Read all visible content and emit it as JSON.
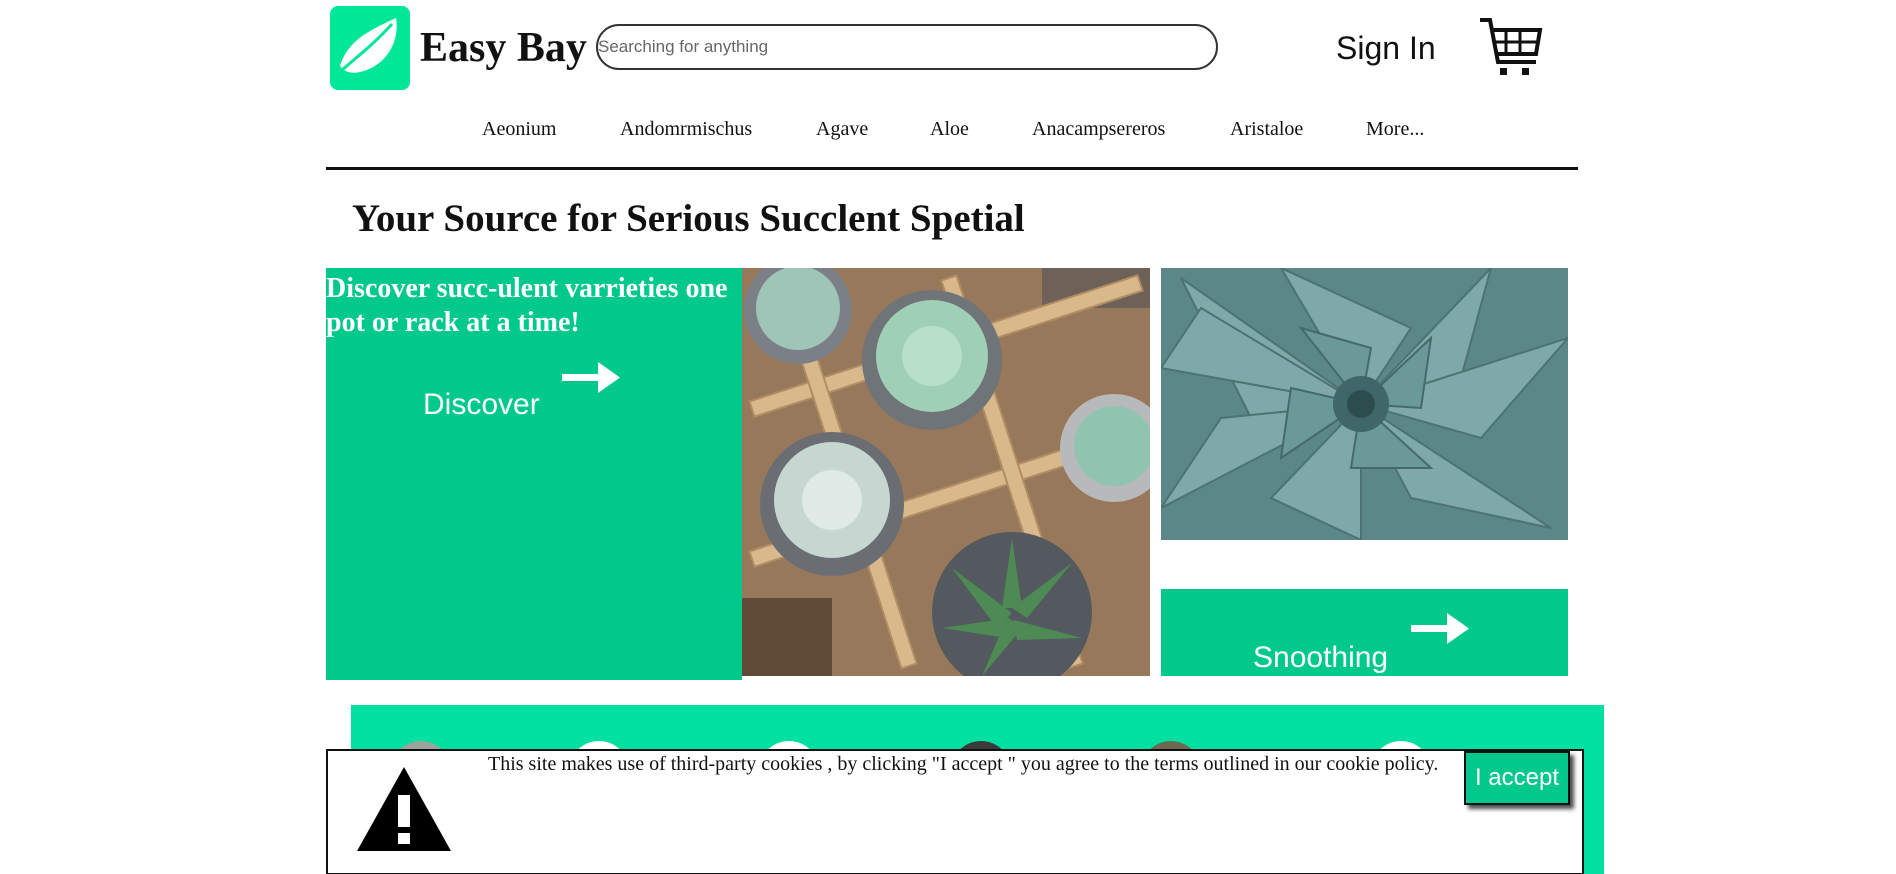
{
  "header": {
    "brand": "Easy Bay",
    "search_placeholder": "Searching for anything",
    "sign_in": "Sign In",
    "logo_icon": "leaf-icon",
    "cart_icon": "cart-icon"
  },
  "nav": {
    "items": [
      "Aeonium",
      "Andomrmischus",
      "Agave",
      "Aloe",
      "Anacampsereros",
      "Aristaloe",
      "More..."
    ]
  },
  "main": {
    "headline": "Your Source for Serious Succlent Spetial",
    "hero": {
      "text": "Discover succ-ulent varrieties one pot or rack at a time!",
      "cta": "Discover"
    },
    "side_cta": "Snoothing"
  },
  "cookie": {
    "message": "This site makes use of third-party cookies , by clicking \"I accept \" you agree to the terms outlined in our cookie policy.",
    "accept": "I accept",
    "icon": "warning-icon"
  },
  "colors": {
    "brand_green": "#00e897",
    "panel_green": "#00c98b",
    "band_green": "#00e0a0"
  }
}
